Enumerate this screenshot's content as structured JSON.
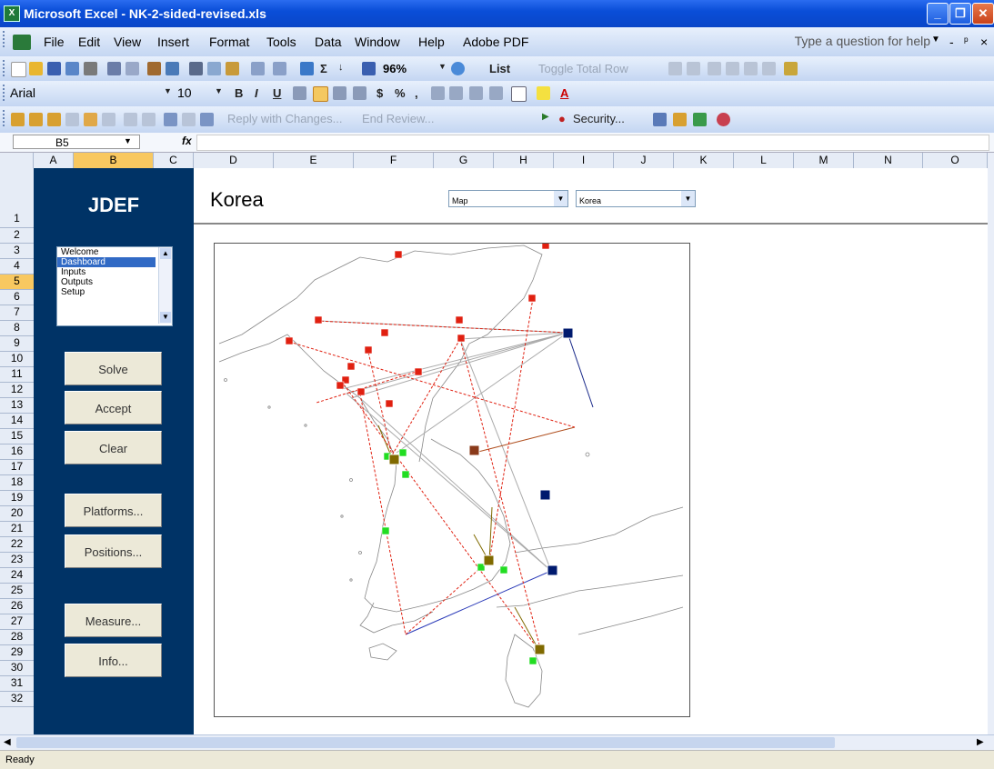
{
  "window": {
    "title": "Microsoft Excel - NK-2-sided-revised.xls"
  },
  "menu": {
    "items": [
      "File",
      "Edit",
      "View",
      "Insert",
      "Format",
      "Tools",
      "Data",
      "Window",
      "Help",
      "Adobe PDF"
    ],
    "help_placeholder": "Type a question for help"
  },
  "toolbar": {
    "zoom": "96%",
    "list_label": "List",
    "toggle_total_row": "Toggle Total Row",
    "font_name": "Arial",
    "font_size": "10",
    "reply_with_changes": "Reply with Changes...",
    "end_review": "End Review...",
    "security": "Security..."
  },
  "formula_bar": {
    "name_box": "B5",
    "fx": "fx"
  },
  "columns": [
    "A",
    "B",
    "C",
    "D",
    "E",
    "F",
    "G",
    "H",
    "I",
    "J",
    "K",
    "L",
    "M",
    "N",
    "O"
  ],
  "selected_column": "B",
  "rows": [
    "1",
    "2",
    "3",
    "4",
    "5",
    "6",
    "7",
    "8",
    "9",
    "10",
    "11",
    "12",
    "13",
    "14",
    "15",
    "16",
    "17",
    "18",
    "19",
    "20",
    "21",
    "22",
    "23",
    "24",
    "25",
    "26",
    "27",
    "28",
    "29",
    "30",
    "31",
    "32"
  ],
  "selected_row": "5",
  "sidebar": {
    "brand": "JDEF",
    "nav_items": [
      "Welcome",
      "Dashboard",
      "Inputs",
      "Outputs",
      "Setup"
    ],
    "nav_selected": "Dashboard",
    "buttons": {
      "solve": "Solve",
      "accept": "Accept",
      "clear": "Clear",
      "platforms": "Platforms...",
      "positions": "Positions...",
      "measure": "Measure...",
      "info": "Info..."
    }
  },
  "main": {
    "title": "Korea",
    "view_select": "Map",
    "region_select": "Korea"
  },
  "map_colors": {
    "red_site": "#e02010",
    "green_site": "#22dd22",
    "blue_site": "#001a6e",
    "olive_site": "#806a00",
    "brown_site": "#8a3a1a"
  },
  "status": {
    "text": "Ready"
  }
}
